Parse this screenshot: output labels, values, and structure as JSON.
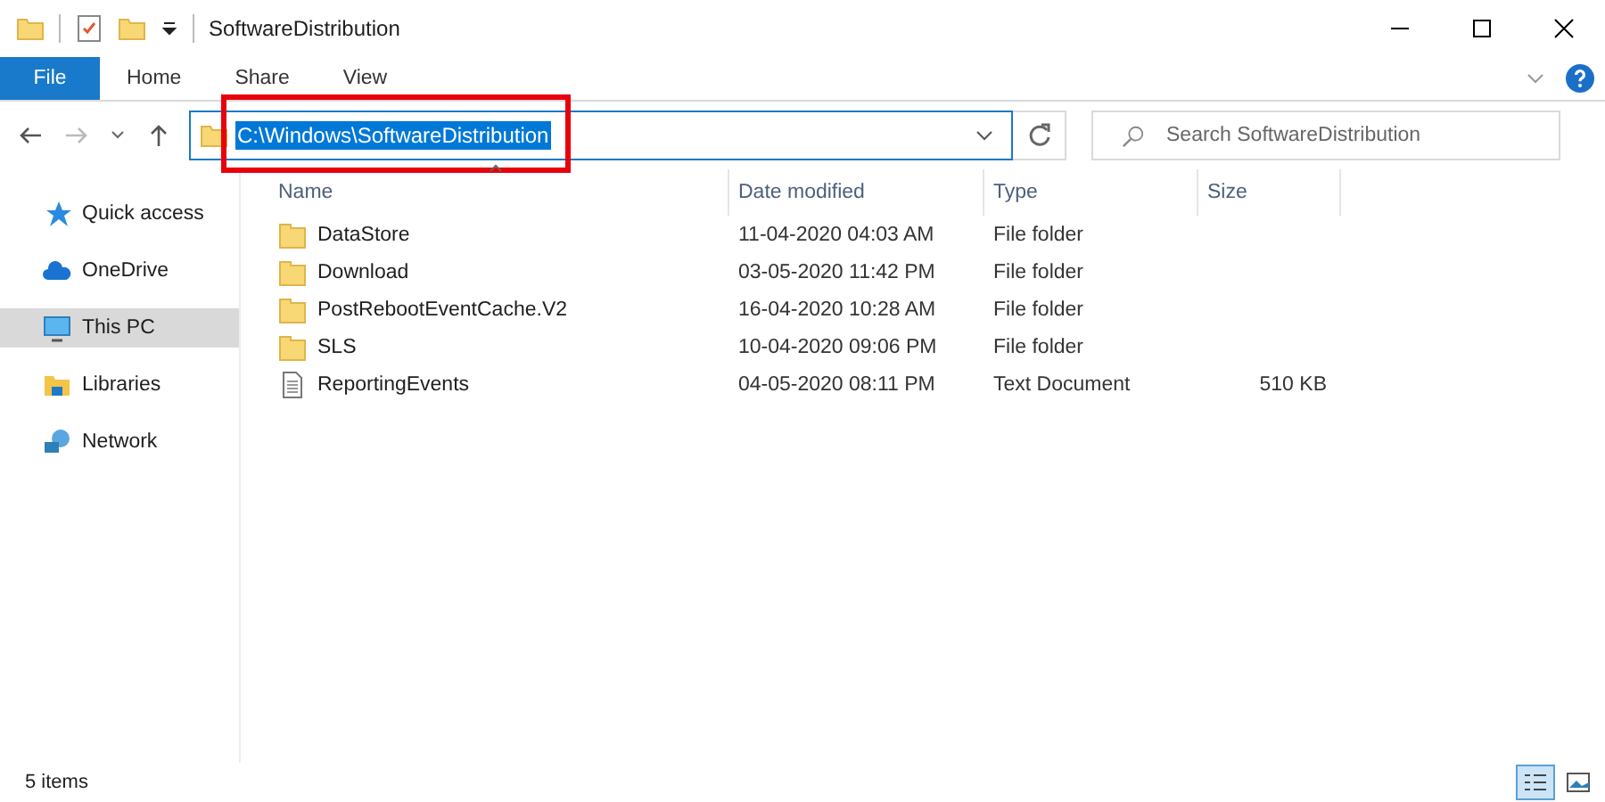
{
  "window": {
    "title": "SoftwareDistribution"
  },
  "ribbon_tabs": [
    {
      "label": "File",
      "kind": "file",
      "selected": false
    },
    {
      "label": "Home",
      "kind": "tab",
      "selected": false
    },
    {
      "label": "Share",
      "kind": "tab",
      "selected": false
    },
    {
      "label": "View",
      "kind": "tab",
      "selected": false
    }
  ],
  "address_bar": {
    "value": "C:\\Windows\\SoftwareDistribution",
    "selected": true,
    "highlighted": true
  },
  "search": {
    "placeholder": "Search SoftwareDistribution"
  },
  "sidebar": {
    "items": [
      {
        "label": "Quick access",
        "selected": false
      },
      {
        "label": "OneDrive",
        "selected": false
      },
      {
        "label": "This PC",
        "selected": true
      },
      {
        "label": "Libraries",
        "selected": false
      },
      {
        "label": "Network",
        "selected": false
      }
    ]
  },
  "table": {
    "columns": [
      "Name",
      "Date modified",
      "Type",
      "Size"
    ],
    "rows": [
      {
        "kind": "folder",
        "name": "DataStore",
        "date": "11-04-2020 04:03 AM",
        "type": "File folder",
        "size": ""
      },
      {
        "kind": "folder",
        "name": "Download",
        "date": "03-05-2020 11:42 PM",
        "type": "File folder",
        "size": ""
      },
      {
        "kind": "folder",
        "name": "PostRebootEventCache.V2",
        "date": "16-04-2020 10:28 AM",
        "type": "File folder",
        "size": ""
      },
      {
        "kind": "folder",
        "name": "SLS",
        "date": "10-04-2020 09:06 PM",
        "type": "File folder",
        "size": ""
      },
      {
        "kind": "document",
        "name": "ReportingEvents",
        "date": "04-05-2020 08:11 PM",
        "type": "Text Document",
        "size": "510 KB"
      }
    ]
  },
  "status_bar": {
    "count": "5 items",
    "views": [
      {
        "kind": "details",
        "selected": true
      },
      {
        "kind": "large",
        "selected": false
      }
    ]
  }
}
